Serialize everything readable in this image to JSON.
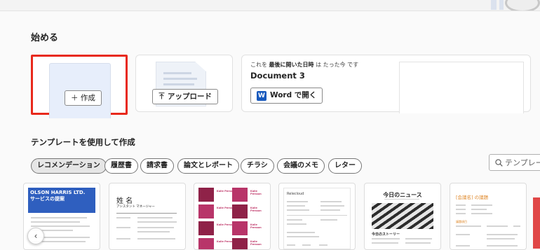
{
  "start_section": {
    "heading": "始める",
    "create": {
      "label": "＋ 作成"
    },
    "upload": {
      "label": "アップロード",
      "icon": "upload-icon"
    },
    "recent": {
      "meta_prefix": "これを",
      "meta_bold": "最後に開いた日時",
      "meta_suffix": "は たった今 です",
      "title": "Document 3",
      "open_label": "Word で開く",
      "word_icon_letter": "W"
    }
  },
  "templates_section": {
    "heading": "テンプレートを使用して作成",
    "filters": [
      "レコメンデーション",
      "履歴書",
      "請求書",
      "論文とレポート",
      "チラシ",
      "会議のメモ",
      "レター"
    ],
    "search_placeholder": "テンプレートを検索",
    "cards": [
      {
        "line1": "OLSON HARRIS LTD.",
        "line2": "サービスの提案"
      },
      {
        "name": "姓 名",
        "subtitle": "アシスタント マネージャー"
      },
      {
        "sample": "Kalle Persson"
      },
      {
        "label": "Relecloud"
      },
      {
        "title": "今日のニュース",
        "story": "今日のストーリー"
      },
      {
        "title": "[会議名] の議題",
        "label": "議題項目"
      }
    ]
  },
  "colors": {
    "accent": "#185abd",
    "highlight": "#e8291c",
    "proposal_blue": "#2f5fbf",
    "flyer_magenta": "#8f2248"
  }
}
